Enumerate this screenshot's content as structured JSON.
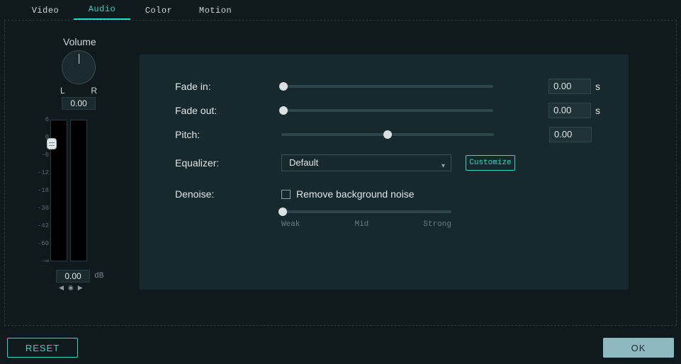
{
  "tabs": {
    "video": "Video",
    "audio": "Audio",
    "color": "Color",
    "motion": "Motion",
    "active": "audio"
  },
  "volume": {
    "title": "Volume",
    "left_label": "L",
    "right_label": "R",
    "pan_value": "0.00",
    "db_value": "0.00",
    "db_unit": "dB",
    "scale": [
      "6",
      "0",
      "-6",
      "-12",
      "-18",
      "-30",
      "-42",
      "-60",
      "-∞"
    ]
  },
  "settings": {
    "fade_in": {
      "label": "Fade in:",
      "value": "0.00",
      "unit": "s",
      "ratio": 0
    },
    "fade_out": {
      "label": "Fade out:",
      "value": "0.00",
      "unit": "s",
      "ratio": 0
    },
    "pitch": {
      "label": "Pitch:",
      "value": "0.00",
      "ratio": 0.5
    },
    "equalizer": {
      "label": "Equalizer:",
      "selected": "Default",
      "button": "Customize"
    },
    "denoise": {
      "label": "Denoise:",
      "checkbox_label": "Remove background noise",
      "checked": false,
      "ratio": 0,
      "scale_labels": {
        "weak": "Weak",
        "mid": "Mid",
        "strong": "Strong"
      }
    }
  },
  "footer": {
    "reset": "RESET",
    "ok": "OK"
  },
  "colors": {
    "accent": "#2fd7c8",
    "panel": "#17292d",
    "bg": "#0e1a1c"
  }
}
